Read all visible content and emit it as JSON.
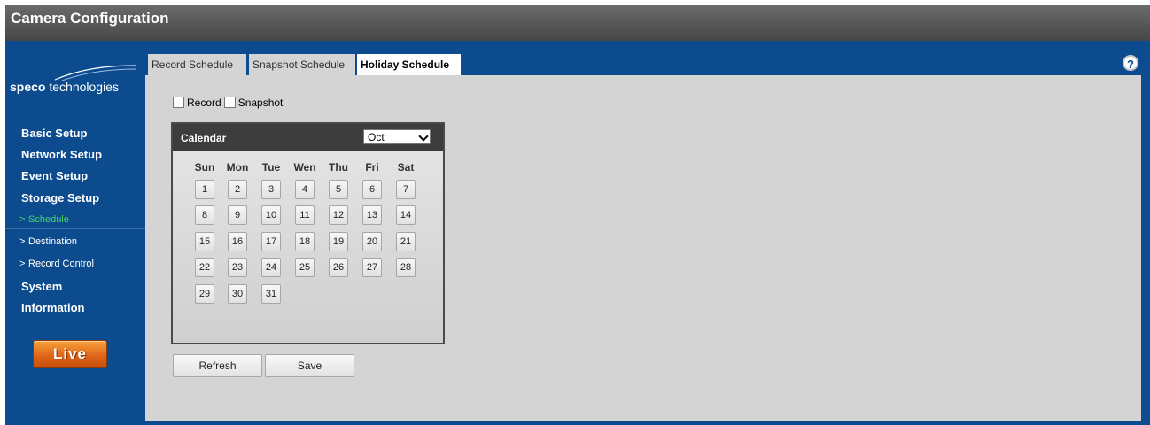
{
  "header": {
    "title": "Camera Configuration"
  },
  "logo": {
    "bold": "speco",
    "text": " technologies"
  },
  "sidebar": {
    "items": [
      {
        "label": "Basic Setup"
      },
      {
        "label": "Network Setup"
      },
      {
        "label": "Event Setup"
      },
      {
        "label": "Storage Setup"
      },
      {
        "label": "Schedule",
        "chevron": ">"
      },
      {
        "label": "Destination",
        "chevron": ">"
      },
      {
        "label": "Record Control",
        "chevron": ">"
      },
      {
        "label": "System"
      },
      {
        "label": "Information"
      }
    ],
    "live_label": "Live"
  },
  "tabs": [
    {
      "label": "Record Schedule"
    },
    {
      "label": "Snapshot Schedule"
    },
    {
      "label": "Holiday Schedule"
    }
  ],
  "help": {
    "glyph": "?"
  },
  "options": {
    "record_label": "Record",
    "snapshot_label": "Snapshot"
  },
  "calendar": {
    "title": "Calendar",
    "month": "Oct",
    "weekdays": [
      "Sun",
      "Mon",
      "Tue",
      "Wen",
      "Thu",
      "Fri",
      "Sat"
    ],
    "days": [
      "1",
      "2",
      "3",
      "4",
      "5",
      "6",
      "7",
      "8",
      "9",
      "10",
      "11",
      "12",
      "13",
      "14",
      "15",
      "16",
      "17",
      "18",
      "19",
      "20",
      "21",
      "22",
      "23",
      "24",
      "25",
      "26",
      "27",
      "28",
      "29",
      "30",
      "31"
    ]
  },
  "buttons": {
    "refresh_label": "Refresh",
    "save_label": "Save"
  }
}
